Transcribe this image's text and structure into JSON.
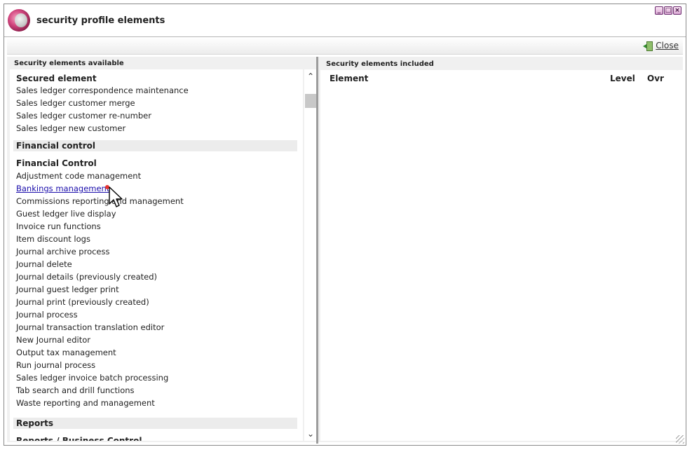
{
  "window": {
    "title": "security profile elements",
    "controls": [
      "minimize-icon",
      "maximize-icon",
      "close-window-icon"
    ]
  },
  "toolbar": {
    "close_label": "Close",
    "close_icon": "exit-door-icon"
  },
  "left_pane": {
    "header": "Security elements available",
    "rows": [
      {
        "type": "heading",
        "text": "Secured element"
      },
      {
        "type": "item",
        "text": "Sales ledger correspondence maintenance"
      },
      {
        "type": "item",
        "text": "Sales ledger customer merge"
      },
      {
        "type": "item",
        "text": "Sales ledger customer re-number"
      },
      {
        "type": "item",
        "text": "Sales ledger new customer"
      },
      {
        "type": "group",
        "text": "Financial control"
      },
      {
        "type": "heading",
        "text": "Financial Control"
      },
      {
        "type": "item",
        "text": "Adjustment code management"
      },
      {
        "type": "link",
        "text": "Bankings management"
      },
      {
        "type": "item",
        "text": "Commissions reporting and management"
      },
      {
        "type": "item",
        "text": "Guest ledger live display"
      },
      {
        "type": "item",
        "text": "Invoice run functions"
      },
      {
        "type": "item",
        "text": "Item discount logs"
      },
      {
        "type": "item",
        "text": "Journal archive process"
      },
      {
        "type": "item",
        "text": "Journal delete"
      },
      {
        "type": "item",
        "text": "Journal details (previously created)"
      },
      {
        "type": "item",
        "text": "Journal guest ledger print"
      },
      {
        "type": "item",
        "text": "Journal print (previously created)"
      },
      {
        "type": "item",
        "text": "Journal process"
      },
      {
        "type": "item",
        "text": "Journal transaction translation editor"
      },
      {
        "type": "item",
        "text": "New Journal editor"
      },
      {
        "type": "item",
        "text": "Output tax management"
      },
      {
        "type": "item",
        "text": "Run journal process"
      },
      {
        "type": "item",
        "text": "Sales ledger invoice batch processing"
      },
      {
        "type": "item",
        "text": "Tab search and drill functions"
      },
      {
        "type": "item",
        "text": "Waste reporting and management"
      },
      {
        "type": "group",
        "text": "Reports"
      },
      {
        "type": "heading",
        "text": "Reports / Business Control"
      }
    ]
  },
  "right_pane": {
    "header": "Security elements included",
    "columns": {
      "element": "Element",
      "level": "Level",
      "ovr": "Ovr"
    }
  }
}
